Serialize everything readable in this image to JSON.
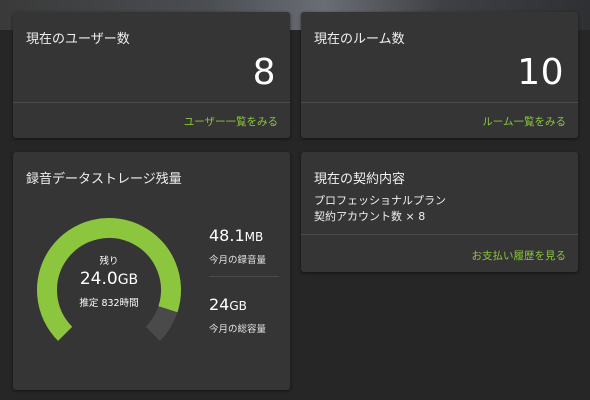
{
  "users_card": {
    "title": "現在のユーザー数",
    "count": "8",
    "link": "ユーザー一覧をみる"
  },
  "rooms_card": {
    "title": "現在のルーム数",
    "count": "10",
    "link": "ルーム一覧をみる"
  },
  "storage_card": {
    "title": "録音データストレージ残量",
    "gauge": {
      "remaining_label": "残り",
      "remaining_value": "24.0",
      "remaining_unit": "GB",
      "estimate": "推定 832時間",
      "fill_fraction": 0.9,
      "color": "#8cc63f"
    },
    "stats": [
      {
        "value": "48.1",
        "unit": "MB",
        "label": "今月の録音量"
      },
      {
        "value": "24",
        "unit": "GB",
        "label": "今月の総容量"
      }
    ]
  },
  "contract_card": {
    "title": "現在の契約内容",
    "plan": "プロフェッショナルプラン",
    "accounts": "契約アカウント数 × 8",
    "link": "お支払い履歴を見る"
  },
  "colors": {
    "background": "#262626",
    "card": "#353535",
    "accent": "#8cc63f"
  }
}
